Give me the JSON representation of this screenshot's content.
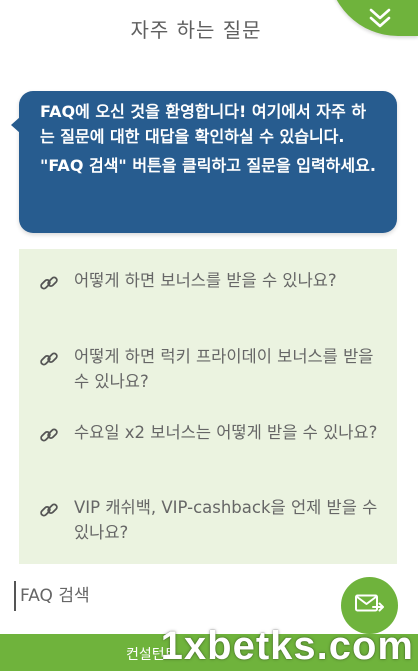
{
  "header": {
    "title": "자주 하는 질문",
    "collapse_icon": "double-chevron-down-icon"
  },
  "welcome": {
    "line1": "FAQ에 오신 것을 환영합니다! 여기에서 자주 하는 질문에 대한 대답을 확인하실 수 있습니다.",
    "line2": "\"FAQ 검색\" 버튼을 클릭하고 질문을 입력하세요."
  },
  "faq": {
    "items": [
      {
        "icon": "link-icon",
        "question": "어떻게 하면 보너스를 받을 수 있나요?"
      },
      {
        "icon": "link-icon",
        "question": "어떻게 하면 럭키 프라이데이 보너스를 받을 수 있나요?"
      },
      {
        "icon": "link-icon",
        "question": "수요일 x2 보너스는 어떻게 받을 수 있나요?"
      },
      {
        "icon": "link-icon",
        "question": "VIP 캐쉬백, VIP-cashback을 언제 받을 수 있나요?"
      }
    ]
  },
  "search": {
    "placeholder": "FAQ 검색",
    "send_icon": "send-mail-icon"
  },
  "footer": {
    "consult_label": "컨설턴트",
    "watermark": "1xbetks.com"
  },
  "colors": {
    "accent_green": "#6fb33c",
    "bubble_blue": "#275c8f",
    "faq_background": "#ebf3e0"
  }
}
